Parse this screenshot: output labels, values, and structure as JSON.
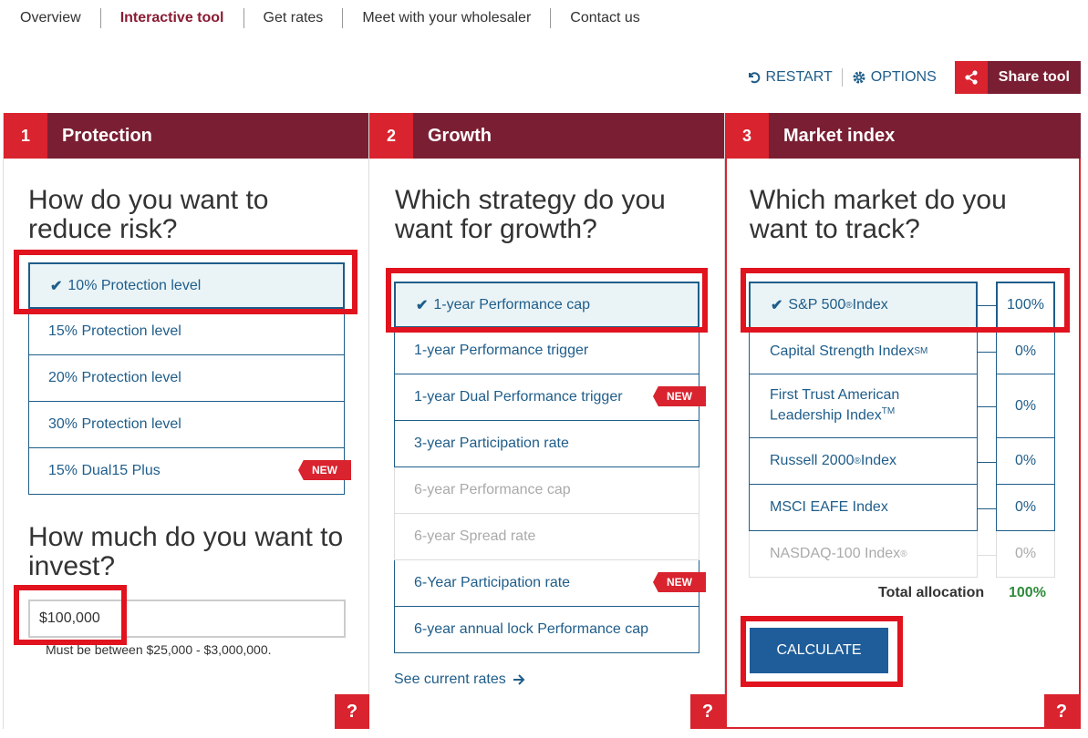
{
  "nav": {
    "items": [
      "Overview",
      "Interactive tool",
      "Get rates",
      "Meet with your wholesaler",
      "Contact us"
    ],
    "active_index": 1
  },
  "toolbar": {
    "restart_label": "RESTART",
    "options_label": "OPTIONS",
    "share_label": "Share tool"
  },
  "colors": {
    "brand_red": "#d9232e",
    "brand_maroon": "#7a1f33",
    "link_blue": "#1f5d8a",
    "total_green": "#2e8b3a"
  },
  "steps": [
    {
      "number": "1",
      "title": "Protection"
    },
    {
      "number": "2",
      "title": "Growth"
    },
    {
      "number": "3",
      "title": "Market index"
    }
  ],
  "protection": {
    "question": "How do you want to reduce risk?",
    "options": [
      {
        "label": "10% Protection level",
        "selected": true
      },
      {
        "label": "15% Protection level"
      },
      {
        "label": "20% Protection level"
      },
      {
        "label": "30% Protection level"
      },
      {
        "label": "15% Dual15 Plus",
        "badge": "NEW"
      }
    ],
    "invest_question": "How much do you want to invest?",
    "invest_value": "$100,000",
    "invest_hint": "Must be between $25,000 - $3,000,000."
  },
  "growth": {
    "question": "Which strategy do you want for growth?",
    "options": [
      {
        "label": "1-year Performance cap",
        "selected": true
      },
      {
        "label": "1-year Performance trigger"
      },
      {
        "label": "1-year Dual Performance trigger",
        "badge": "NEW"
      },
      {
        "label": "3-year Participation rate"
      },
      {
        "label": "6-year Performance cap",
        "disabled": true
      },
      {
        "label": "6-year Spread rate",
        "disabled": true
      },
      {
        "label": "6-Year Participation rate",
        "badge": "NEW"
      },
      {
        "label": "6-year annual lock Performance cap"
      }
    ],
    "see_rates": "See current rates"
  },
  "market": {
    "question": "Which market do you want to track?",
    "indexes": [
      {
        "name": "S&P 500",
        "sup": "®",
        "suffix": " Index",
        "pct": "100%",
        "selected": true
      },
      {
        "name": "Capital Strength Index",
        "sup": "SM",
        "suffix": "",
        "pct": "0%"
      },
      {
        "name": "First Trust American Leadership Index",
        "sup": "TM",
        "suffix": "",
        "pct": "0%"
      },
      {
        "name": "Russell 2000",
        "sup": "®",
        "suffix": " Index",
        "pct": "0%"
      },
      {
        "name": "MSCI EAFE Index",
        "sup": "",
        "suffix": "",
        "pct": "0%"
      },
      {
        "name": "NASDAQ-100 Index",
        "sup": "®",
        "suffix": "",
        "pct": "0%",
        "disabled": true
      }
    ],
    "total_label": "Total allocation",
    "total_value": "100%",
    "calculate_label": "CALCULATE"
  },
  "help_label": "?",
  "new_badge": "NEW"
}
